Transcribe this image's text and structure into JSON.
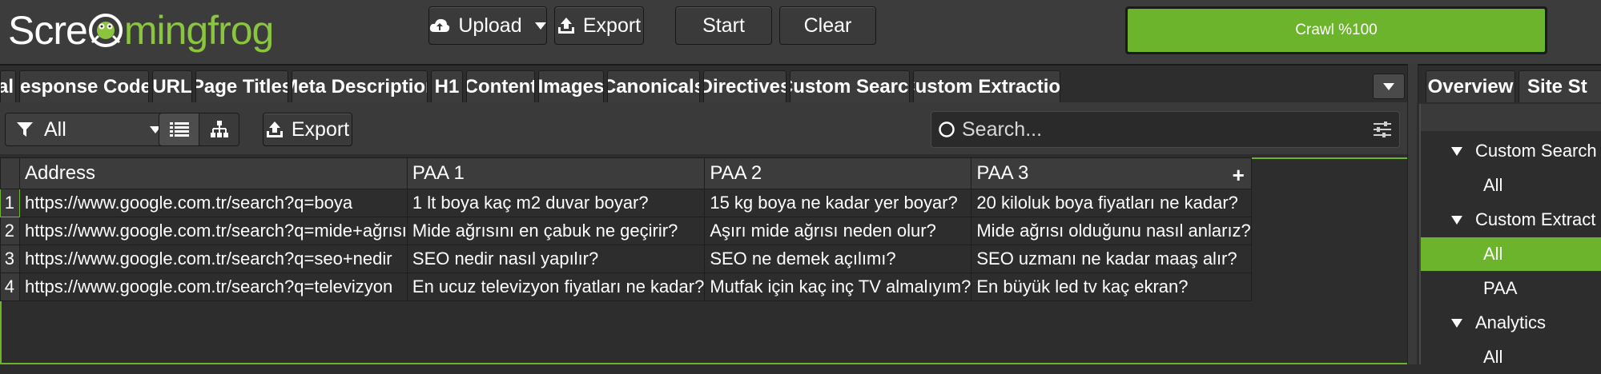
{
  "app": {
    "logo_part1": "Scre",
    "logo_part2": "mingfrog",
    "logo_icon": "frog-icon"
  },
  "toolbar": {
    "upload_label": "Upload",
    "export_label": "Export",
    "start_label": "Start",
    "clear_label": "Clear",
    "crawl_label": "Crawl %100",
    "crawl_progress": 1.0
  },
  "tabs": [
    {
      "label": "al"
    },
    {
      "label": "Response Codes"
    },
    {
      "label": "URL"
    },
    {
      "label": "Page Titles"
    },
    {
      "label": "Meta Description"
    },
    {
      "label": "H1"
    },
    {
      "label": "Content"
    },
    {
      "label": "Images"
    },
    {
      "label": "Canonicals"
    },
    {
      "label": "Directives"
    },
    {
      "label": "Custom Search"
    },
    {
      "label": "Custom Extraction"
    }
  ],
  "right_tabs": [
    {
      "label": "Overview"
    },
    {
      "label": "Site St"
    }
  ],
  "filter": {
    "selected": "All",
    "export_label": "Export",
    "search_placeholder": "Search..."
  },
  "table": {
    "columns": [
      "Address",
      "PAA 1",
      "PAA 2",
      "PAA 3"
    ],
    "rows": [
      {
        "num": "1",
        "address": "https://www.google.com.tr/search?q=boya",
        "paa1": "1 lt boya kaç m2 duvar boyar?",
        "paa2": "15 kg boya ne kadar yer boyar?",
        "paa3": "20 kiloluk boya fiyatları ne kadar?"
      },
      {
        "num": "2",
        "address": "https://www.google.com.tr/search?q=mide+ağrısı",
        "paa1": "Mide ağrısını en çabuk ne geçirir?",
        "paa2": "Aşırı mide ağrısı neden olur?",
        "paa3": "Mide ağrısı olduğunu nasıl anlarız?"
      },
      {
        "num": "3",
        "address": "https://www.google.com.tr/search?q=seo+nedir",
        "paa1": "SEO nedir nasıl yapılır?",
        "paa2": "SEO ne demek açılımı?",
        "paa3": "SEO uzmanı ne kadar maaş alır?"
      },
      {
        "num": "4",
        "address": "https://www.google.com.tr/search?q=televizyon",
        "paa1": "En ucuz televizyon fiyatları ne kadar?",
        "paa2": "Mutfak için kaç inç TV almalıyım?",
        "paa3": "En büyük led tv kaç ekran?"
      }
    ]
  },
  "tree": [
    {
      "label": "Custom Search",
      "type": "group"
    },
    {
      "label": "All",
      "type": "leaf"
    },
    {
      "label": "Custom Extract",
      "type": "group"
    },
    {
      "label": "All",
      "type": "leaf",
      "selected": true
    },
    {
      "label": "PAA",
      "type": "leaf"
    },
    {
      "label": "Analytics",
      "type": "group"
    },
    {
      "label": "All",
      "type": "leaf"
    }
  ],
  "colors": {
    "accent": "#6cb42c",
    "logo_green": "#8bc53f",
    "background": "#2d2d2d",
    "toolbar": "#3c3c3c"
  }
}
